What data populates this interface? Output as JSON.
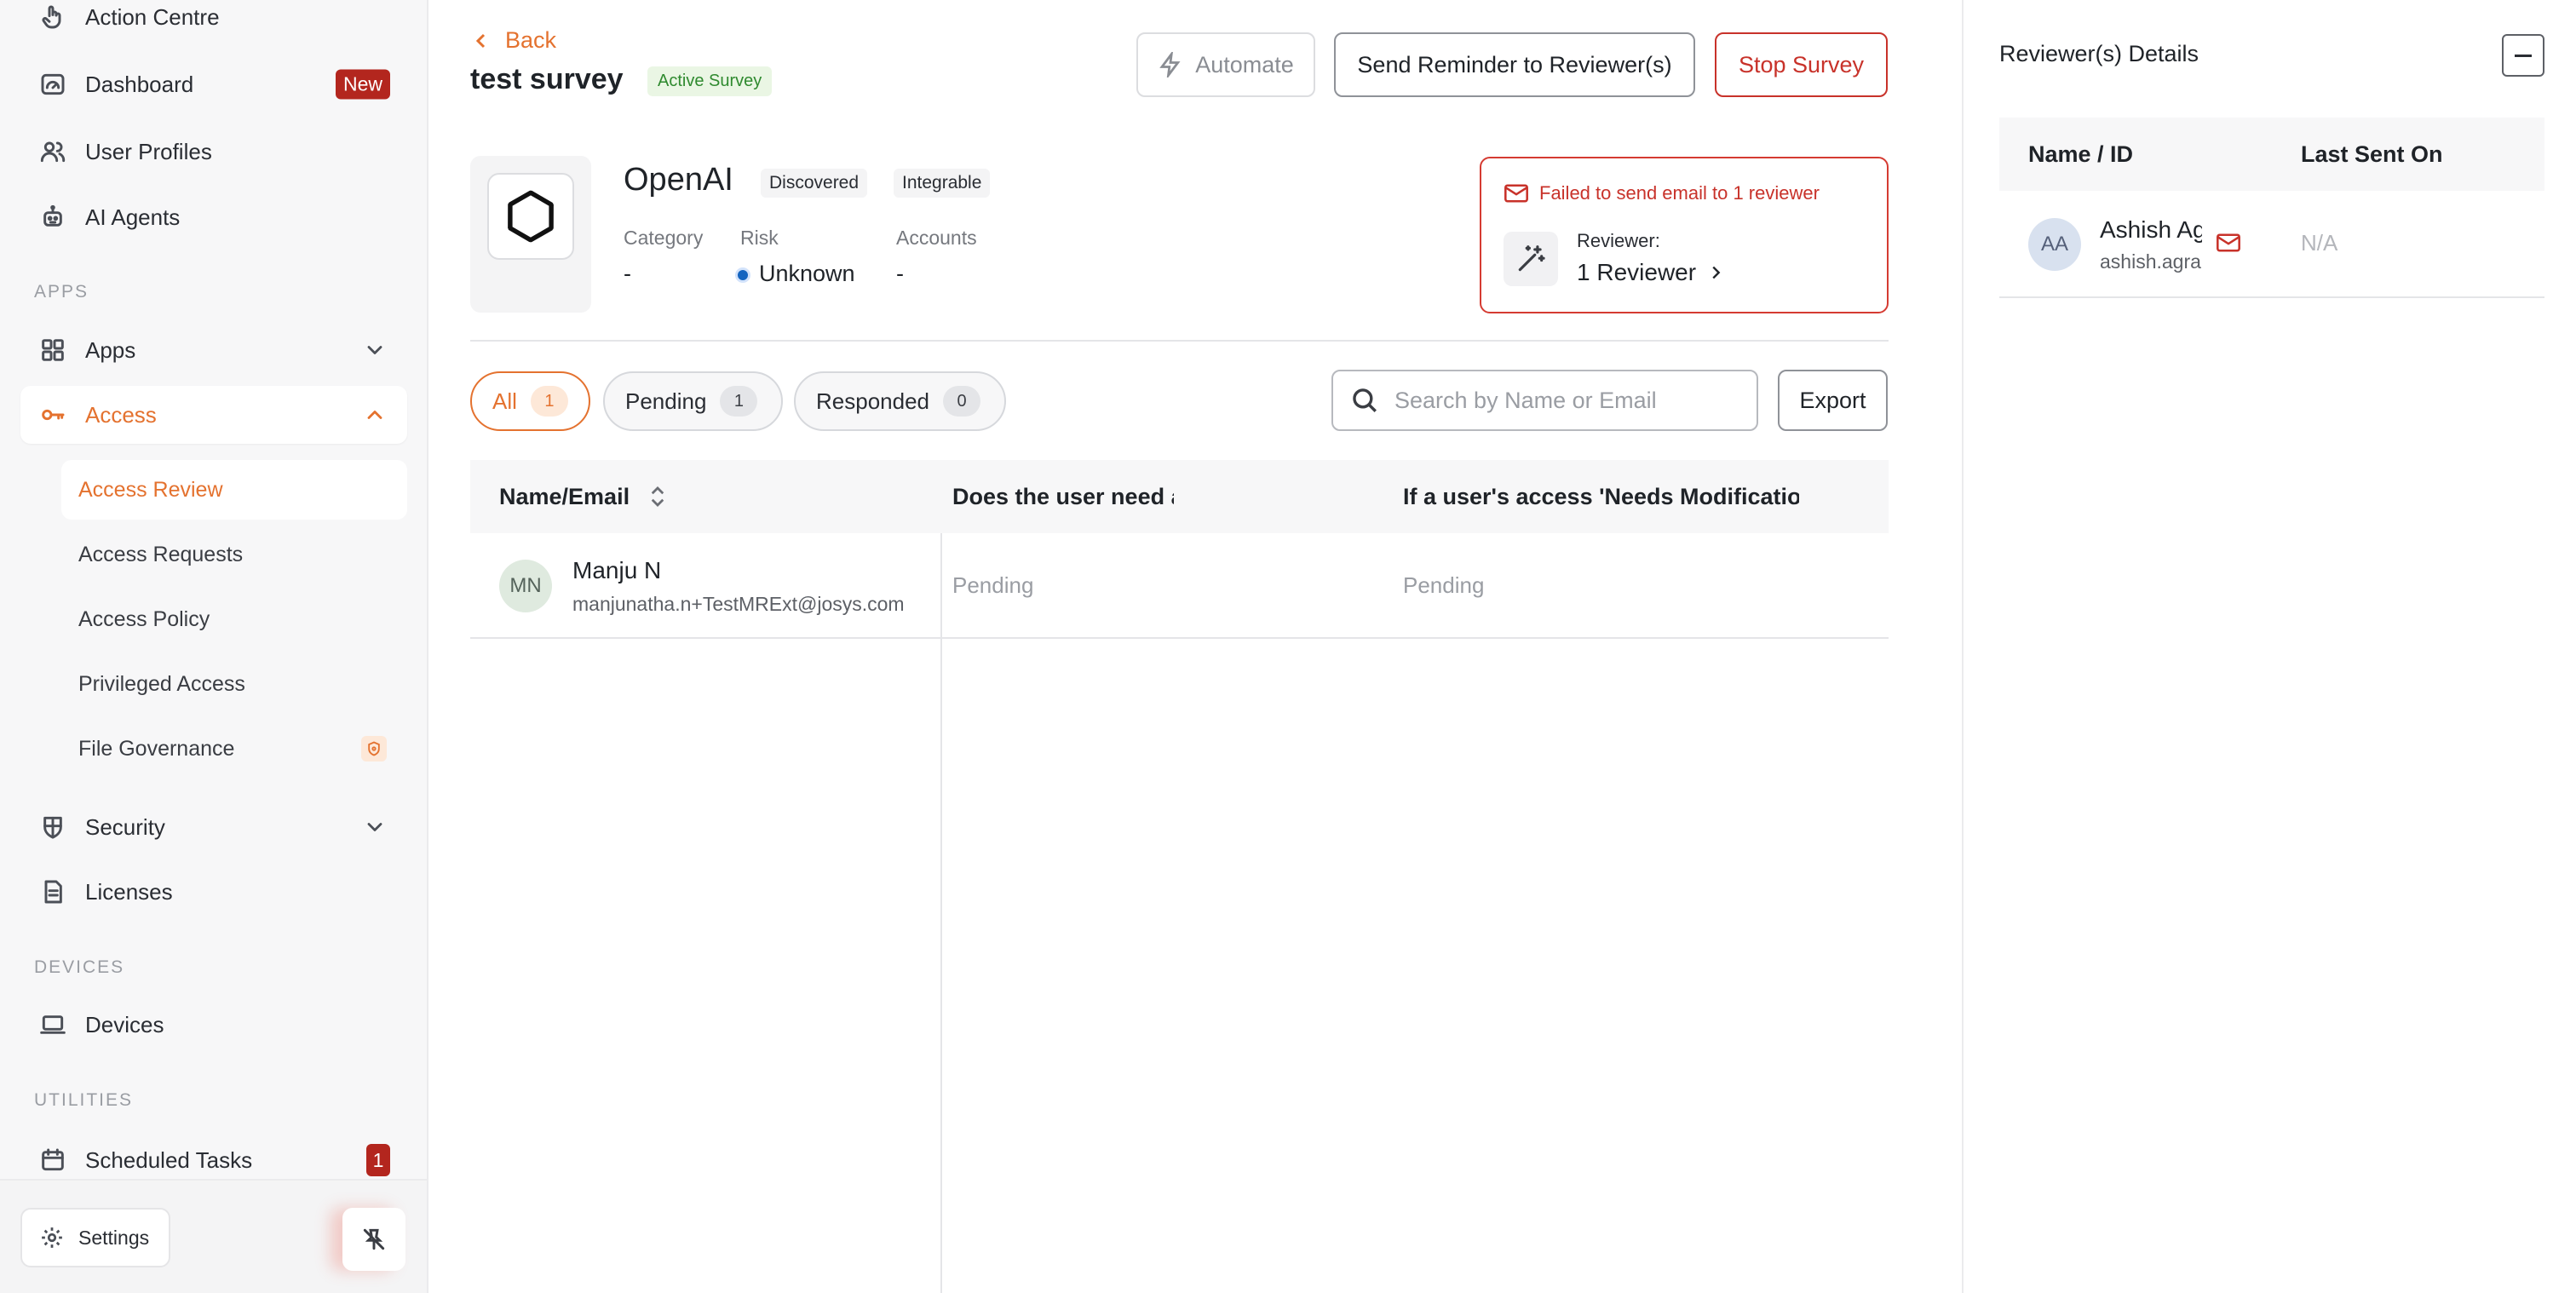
{
  "sidebar": {
    "items": {
      "action_centre": "Action Centre",
      "dashboard": "Dashboard",
      "dashboard_badge": "New",
      "user_profiles": "User Profiles",
      "ai_agents": "AI Agents",
      "apps": "Apps",
      "access": "Access",
      "security": "Security",
      "licenses": "Licenses",
      "devices": "Devices",
      "scheduled_tasks": "Scheduled Tasks",
      "scheduled_tasks_count": "1"
    },
    "sections": {
      "apps": "APPS",
      "devices": "DEVICES",
      "utilities": "UTILITIES"
    },
    "access_sub": {
      "access_review": "Access Review",
      "access_requests": "Access Requests",
      "access_policy": "Access Policy",
      "privileged_access": "Privileged Access",
      "file_governance": "File Governance"
    },
    "settings_label": "Settings"
  },
  "header": {
    "back_label": "Back",
    "survey_title": "test survey",
    "survey_status": "Active Survey",
    "automate_label": "Automate",
    "send_reminder_label": "Send Reminder to Reviewer(s)",
    "stop_survey_label": "Stop Survey"
  },
  "app": {
    "name": "OpenAI",
    "tags": [
      "Discovered",
      "Integrable"
    ],
    "category_label": "Category",
    "category_value": "-",
    "risk_label": "Risk",
    "risk_value": "Unknown",
    "accounts_label": "Accounts",
    "accounts_value": "-"
  },
  "alert": {
    "message": "Failed to send email to 1 reviewer",
    "reviewer_label": "Reviewer:",
    "reviewer_link": "1 Reviewer"
  },
  "tabs": [
    {
      "label": "All",
      "count": "1"
    },
    {
      "label": "Pending",
      "count": "1"
    },
    {
      "label": "Responded",
      "count": "0"
    }
  ],
  "search": {
    "placeholder": "Search by Name or Email"
  },
  "export_label": "Export",
  "table": {
    "columns": [
      "Name/Email",
      "Does the user need access to OpenAI",
      "If a user's access 'Needs Modificatio"
    ],
    "rows": [
      {
        "initials": "MN",
        "name": "Manju N",
        "email": "manjunatha.n+TestMRExt@josys.com",
        "q1": "Pending",
        "q2": "Pending"
      }
    ]
  },
  "reviewer_panel": {
    "title": "Reviewer(s) Details",
    "columns": [
      "Name / ID",
      "Last Sent On"
    ],
    "rows": [
      {
        "initials": "AA",
        "name": "Ashish Ag",
        "email": "ashish.agra",
        "last_sent": "N/A"
      }
    ]
  },
  "colors": {
    "accent": "#e4722f",
    "danger": "#c8322a",
    "success": "#2f8a2f",
    "badge_red": "#b3261e"
  }
}
